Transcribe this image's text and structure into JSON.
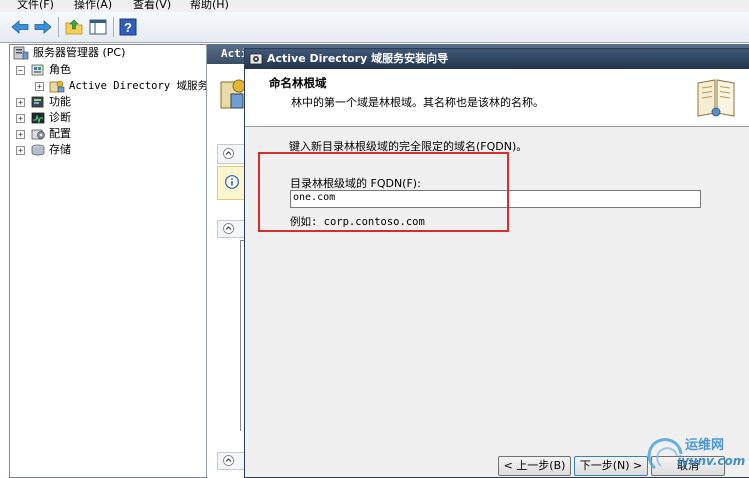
{
  "menu": [
    "文件(F)",
    "操作(A)",
    "查看(V)",
    "帮助(H)"
  ],
  "toolbar_icons": [
    "back-arrow-icon",
    "forward-arrow-icon",
    "up-folder-icon",
    "console-tree-icon",
    "help-icon"
  ],
  "tree": {
    "root": "服务器管理器 (PC)",
    "roles": "角色",
    "ad_role": "Active Directory 域服务",
    "features": "功能",
    "diagnostics": "诊断",
    "config": "配置",
    "storage": "存储"
  },
  "right_pane": {
    "header_fragment": "Acti"
  },
  "dialog": {
    "title": "Active Directory 域服务安装向导",
    "heading": "命名林根域",
    "subheading": "林中的第一个域是林根域。其名称也是该林的名称。",
    "instruction": "键入新目录林根级域的完全限定的域名(FQDN)。",
    "field_label": "目录林根级域的 FQDN(F):",
    "field_value": "one.com",
    "example": "例如: corp.contoso.com",
    "buttons": {
      "back": "< 上一步(B)",
      "next": "下一步(N) >",
      "cancel": "取消"
    }
  },
  "watermark": {
    "name": "运维网",
    "url": "iyunv.com"
  },
  "colors": {
    "highlight": "#d62e2e",
    "title_bar": "#2f4562",
    "dialog_bg": "#f0f0f0"
  }
}
